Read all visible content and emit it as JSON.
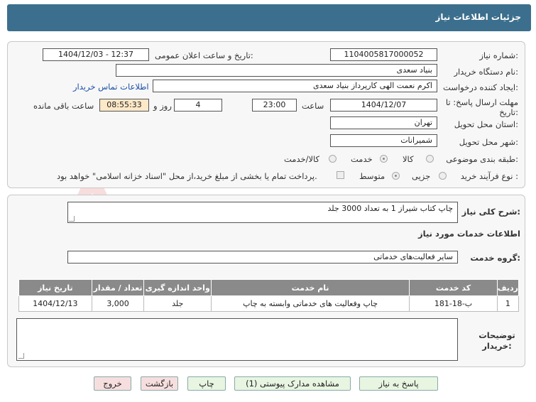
{
  "header": {
    "title": "جزئیات اطلاعات نیاز"
  },
  "form": {
    "need_number_label": "شماره نیاز:",
    "need_number": "1104005817000052",
    "announce_label": "تاریخ و ساعت اعلان عمومی:",
    "announce_value": "1404/12/03 - 12:37",
    "buyer_label": "نام دستگاه خریدار:",
    "buyer_value": "بنیاد سعدی",
    "creator_label": "ایجاد کننده درخواست:",
    "creator_value": "اکرم نعمت الهی کارپرداز بنیاد سعدی",
    "contact_link": "اطلاعات تماس خریدار",
    "deadline_label": "مهلت ارسال پاسخ: تا تاریخ:",
    "deadline_date": "1404/12/07",
    "time_label": "ساعت",
    "deadline_time": "23:00",
    "days_value": "4",
    "days_label": "روز و",
    "remaining_time": "08:55:33",
    "remaining_label": "ساعت باقی مانده",
    "province_label": "استان محل تحویل:",
    "province_value": "تهران",
    "city_label": "شهر محل تحویل:",
    "city_value": "شمیرانات",
    "category_label": "طبقه بندی موضوعی:",
    "category_options": [
      "کالا",
      "خدمت",
      "کالا/خدمت"
    ],
    "category_selected": "خدمت",
    "process_label": "نوع فرآیند خرید :",
    "process_options": [
      "جزیی",
      "متوسط"
    ],
    "process_selected": "متوسط",
    "payment_note": "پرداخت تمام یا بخشی از مبلغ خرید،از محل \"اسناد خزانه اسلامی\" خواهد بود."
  },
  "details": {
    "description_label": "شرح کلی نیاز:",
    "description_value": "چاپ کتاب شیراز 1 به تعداد 3000 جلد",
    "services_heading": "اطلاعات خدمات مورد نیاز",
    "service_group_label": "گروه خدمت:",
    "service_group_value": "سایر فعالیت‌های خدماتی",
    "table": {
      "headers": [
        "ردیف",
        "کد خدمت",
        "نام خدمت",
        "واحد اندازه گیری",
        "تعداد / مقدار",
        "تاریخ نیاز"
      ],
      "rows": [
        [
          "1",
          "ب-18-181",
          "چاپ وفعالیت های خدماتی وابسته به چاپ",
          "جلد",
          "3,000",
          "1404/12/13"
        ]
      ]
    },
    "buyer_notes_label": "توضیحات خریدار:",
    "buyer_notes_value": ""
  },
  "buttons": {
    "reply": "پاسخ به نیاز",
    "attachments": "مشاهده مدارک پیوستی (1)",
    "print": "چاپ",
    "back": "بازگشت",
    "exit": "خروج"
  },
  "colors": {
    "header": "#3c6f8d",
    "highlight": "#fde8c7",
    "grid_header": "#8a8a8a",
    "button": "#e8f5e1",
    "button_red": "#f7dede",
    "link": "#1a4fa8"
  },
  "watermark": "AriaTender.net"
}
